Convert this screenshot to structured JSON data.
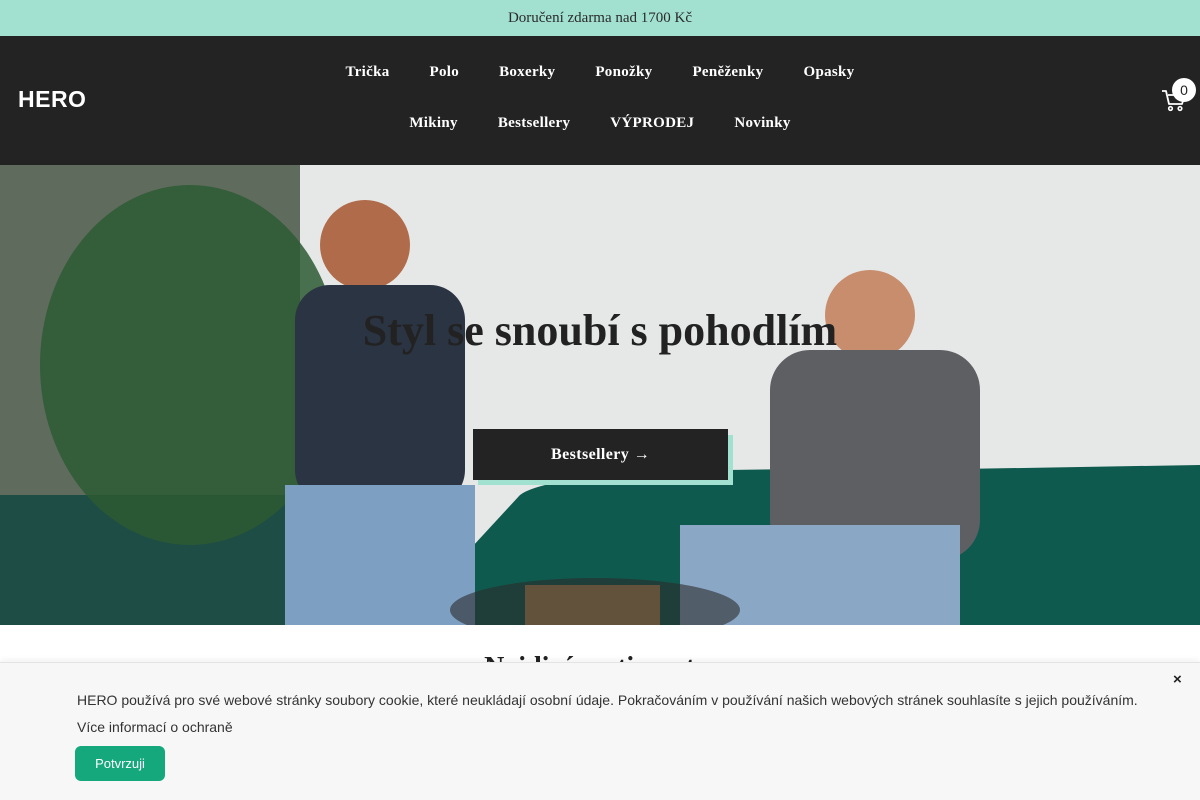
{
  "announcement": {
    "text": "Doručení zdarma nad 1700 Kč"
  },
  "header": {
    "logo": "HERO",
    "nav_row1": [
      "Trička",
      "Polo",
      "Boxerky",
      "Ponožky",
      "Peněženky",
      "Opasky"
    ],
    "nav_row2": [
      "Mikiny",
      "Bestsellery",
      "VÝPRODEJ",
      "Novinky"
    ],
    "cart_count": "0",
    "cart_icon": "cart-icon"
  },
  "hero": {
    "title": "Styl se snoubí s pohodlím",
    "button_label": "Bestsellery →"
  },
  "section": {
    "title_partial": "Nejdiní sortiment..."
  },
  "cookie": {
    "text": "HERO používá pro své webové stránky soubory cookie, které neukládají osobní údaje. Pokračováním v používání našich webových stránek souhlasíte s jejich používáním. Více informací o ochraně",
    "close": "×",
    "button_label": "Potvrzuji"
  },
  "colors": {
    "accent": "#a2e0d0",
    "header_bg": "#232323",
    "confirm_green": "#15a87c"
  }
}
